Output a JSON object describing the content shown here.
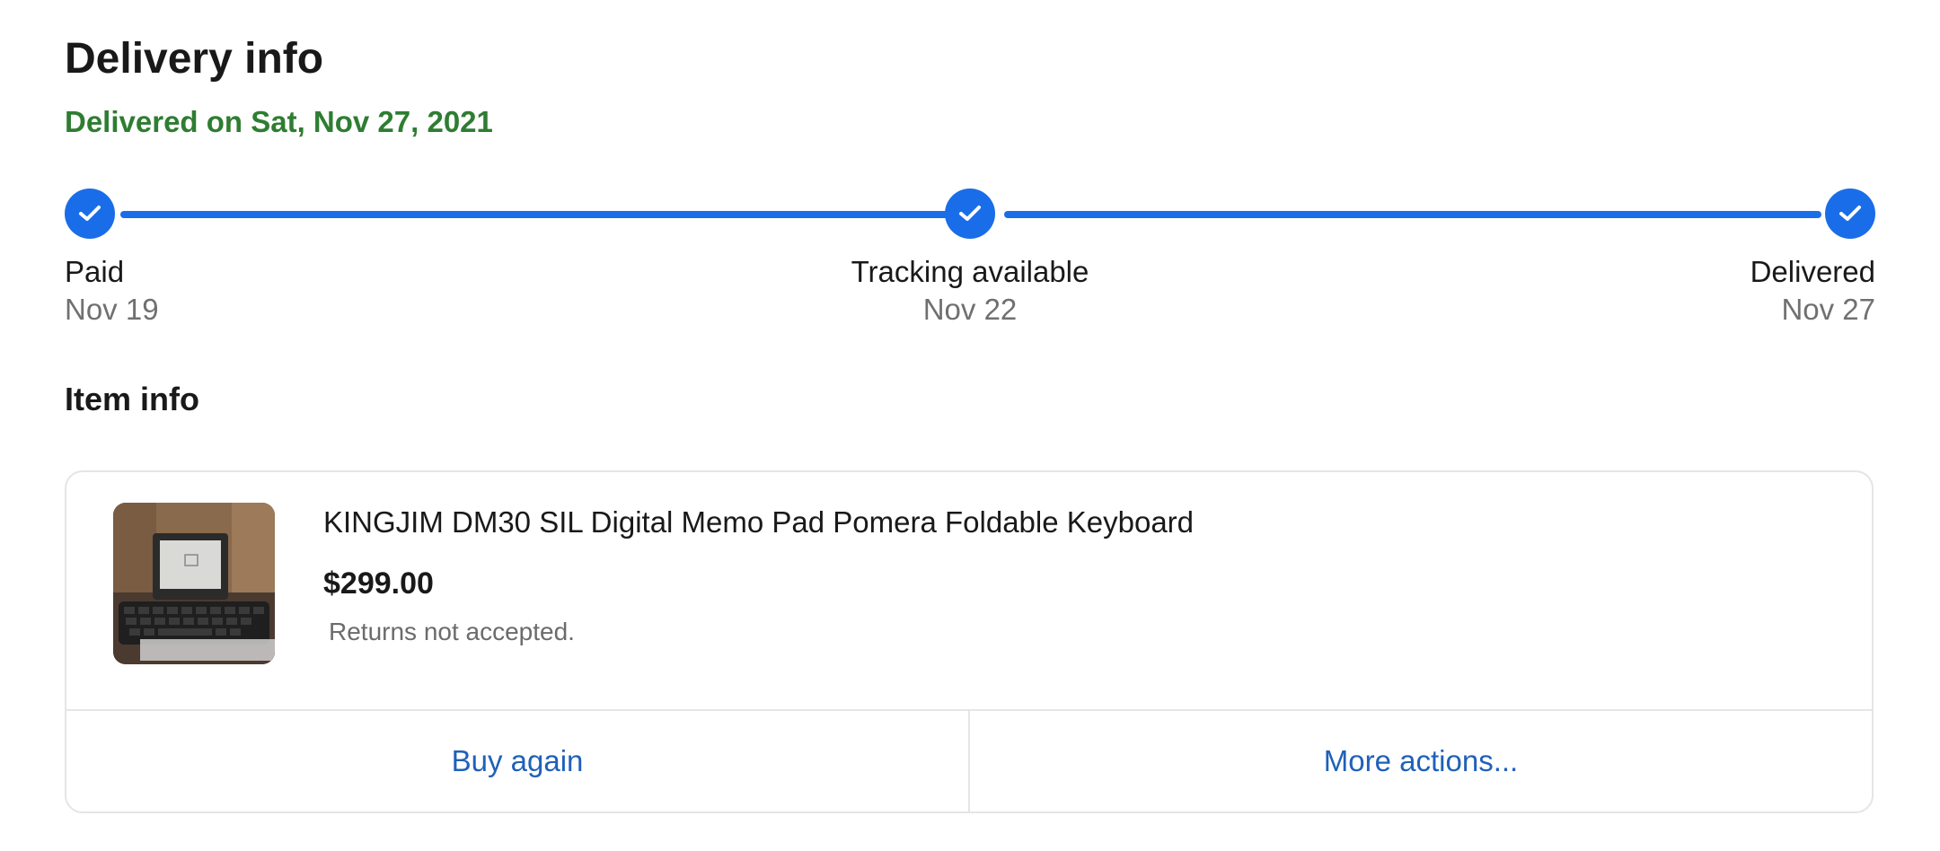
{
  "delivery": {
    "title": "Delivery info",
    "status_text": "Delivered on Sat, Nov 27, 2021",
    "status_color": "#2e7d32",
    "accent_color": "#1a6de8",
    "progress_fraction": 1.0,
    "steps": [
      {
        "label": "Paid",
        "date": "Nov 19",
        "icon": "check-icon",
        "completed": true
      },
      {
        "label": "Tracking available",
        "date": "Nov 22",
        "icon": "check-icon",
        "completed": true
      },
      {
        "label": "Delivered",
        "date": "Nov 27",
        "icon": "check-icon",
        "completed": true
      }
    ]
  },
  "item_info": {
    "title": "Item info",
    "item": {
      "name": "KINGJIM DM30 SIL Digital Memo Pad Pomera Foldable Keyboard",
      "price": "$299.00",
      "returns": "Returns not accepted.",
      "thumbnail_icon": "product-thumbnail"
    },
    "actions": {
      "buy_again_label": "Buy again",
      "more_actions_label": "More actions..."
    },
    "link_color": "#1f61b8"
  }
}
